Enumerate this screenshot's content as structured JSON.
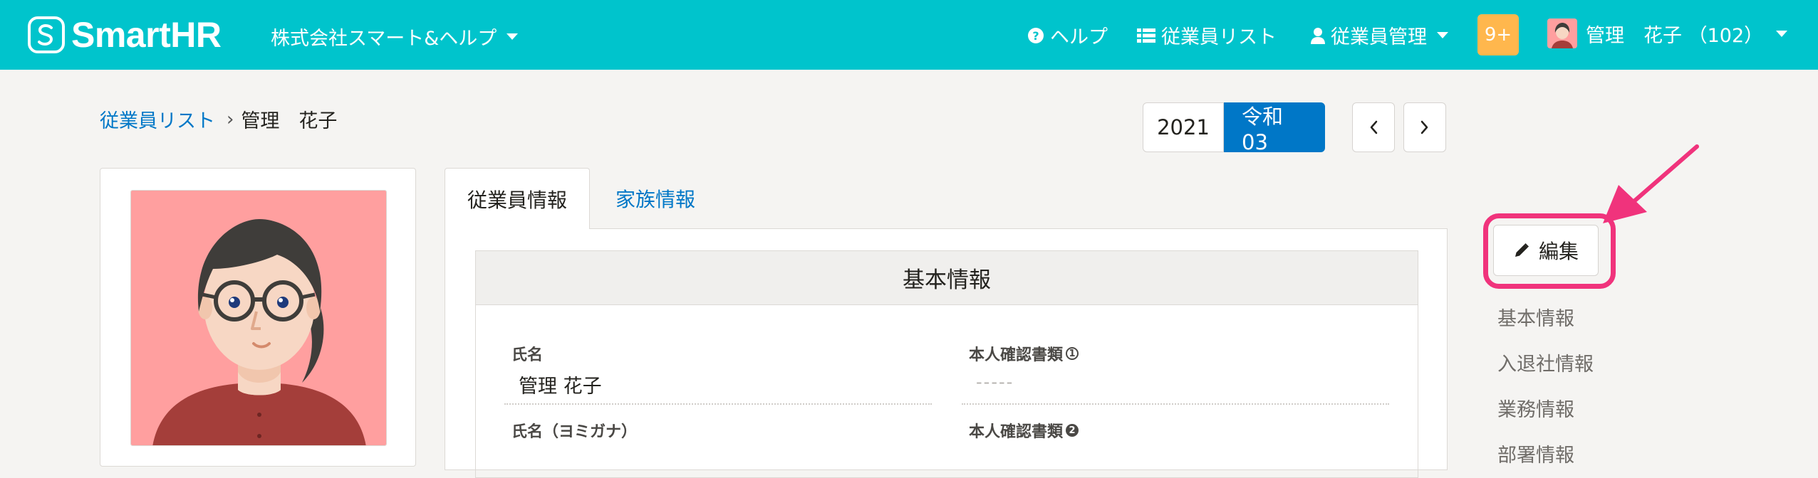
{
  "header": {
    "logo_text": "SmartHR",
    "company_name": "株式会社スマート&ヘルプ",
    "nav": {
      "help": "ヘルプ",
      "employee_list": "従業員リスト",
      "employee_management": "従業員管理"
    },
    "notification_badge": "9+",
    "user_name": "管理　花子 （102）"
  },
  "breadcrumb": {
    "parent": "従業員リスト",
    "separator": "›",
    "current": "管理　花子"
  },
  "year_switch": {
    "year": "2021",
    "era": "令和03"
  },
  "tabs": {
    "employee_info": "従業員情報",
    "family_info": "家族情報"
  },
  "section": {
    "title": "基本情報",
    "fields": {
      "name_label": "氏名",
      "name_value": "管理 花子",
      "id_doc1_label": "本人確認書類",
      "id_doc1_marker": "1",
      "id_doc1_value": "-----",
      "kana_label": "氏名（ヨミガナ）",
      "id_doc2_label": "本人確認書類",
      "id_doc2_marker": "2"
    }
  },
  "side": {
    "edit_label": "編集",
    "links": [
      "基本情報",
      "入退社情報",
      "業務情報",
      "部署情報"
    ]
  },
  "colors": {
    "header_bg": "#00c4cc",
    "link": "#0077c7",
    "primary": "#0077c7",
    "badge": "#ffb74d",
    "annotation": "#f0337c"
  }
}
